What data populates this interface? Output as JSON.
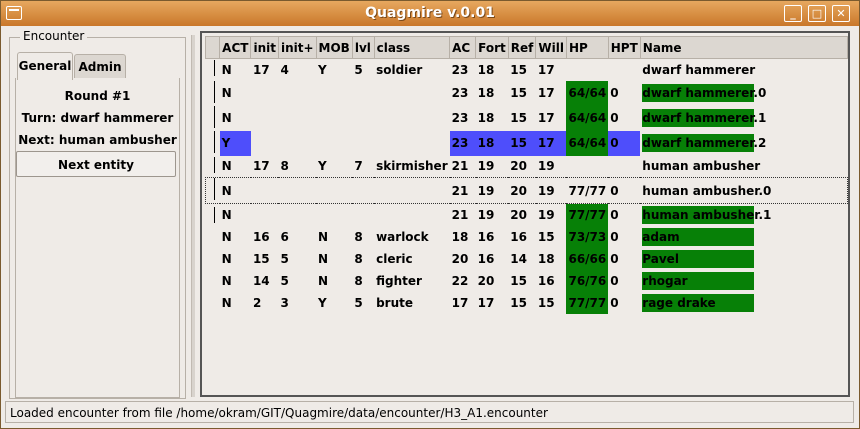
{
  "window": {
    "title": "Quagmire v.0.01"
  },
  "left": {
    "frame_label": "Encounter",
    "tabs": [
      {
        "label": "General"
      },
      {
        "label": "Admin"
      }
    ],
    "round": "Round #1",
    "turn": "Turn: dwarf hammerer",
    "next": "Next: human ambusher",
    "next_button": "Next entity"
  },
  "table": {
    "headers": [
      "ACT",
      "init",
      "init+",
      "MOB",
      "lvl",
      "class",
      "AC",
      "Fort",
      "Ref",
      "Will",
      "HP",
      "HPT",
      "Name"
    ],
    "rows": [
      {
        "act": "N",
        "init": "17",
        "initp": "4",
        "mob": "Y",
        "lvl": "5",
        "cls": "soldier",
        "ac": "23",
        "fort": "18",
        "ref": "15",
        "will": "17",
        "hp": "",
        "hpt": "",
        "name": "dwarf hammerer"
      },
      {
        "act": "N",
        "init": "",
        "initp": "",
        "mob": "",
        "lvl": "",
        "cls": "",
        "ac": "23",
        "fort": "18",
        "ref": "15",
        "will": "17",
        "hp": "64/64",
        "hpt": "0",
        "name": "dwarf hammerer.0"
      },
      {
        "act": "N",
        "init": "",
        "initp": "",
        "mob": "",
        "lvl": "",
        "cls": "",
        "ac": "23",
        "fort": "18",
        "ref": "15",
        "will": "17",
        "hp": "64/64",
        "hpt": "0",
        "name": "dwarf hammerer.1"
      },
      {
        "act": "Y",
        "init": "",
        "initp": "",
        "mob": "",
        "lvl": "",
        "cls": "",
        "ac": "23",
        "fort": "18",
        "ref": "15",
        "will": "17",
        "hp": "64/64",
        "hpt": "0",
        "name": "dwarf hammerer.2"
      },
      {
        "act": "N",
        "init": "17",
        "initp": "8",
        "mob": "Y",
        "lvl": "7",
        "cls": "skirmisher",
        "ac": "21",
        "fort": "19",
        "ref": "20",
        "will": "19",
        "hp": "",
        "hpt": "",
        "name": "human ambusher"
      },
      {
        "act": "N",
        "init": "",
        "initp": "",
        "mob": "",
        "lvl": "",
        "cls": "",
        "ac": "21",
        "fort": "19",
        "ref": "20",
        "will": "19",
        "hp": "77/77",
        "hpt": "0",
        "name": "human ambusher.0"
      },
      {
        "act": "N",
        "init": "",
        "initp": "",
        "mob": "",
        "lvl": "",
        "cls": "",
        "ac": "21",
        "fort": "19",
        "ref": "20",
        "will": "19",
        "hp": "77/77",
        "hpt": "0",
        "name": "human ambusher.1"
      },
      {
        "act": "N",
        "init": "16",
        "initp": "6",
        "mob": "N",
        "lvl": "8",
        "cls": "warlock",
        "ac": "18",
        "fort": "16",
        "ref": "16",
        "will": "15",
        "hp": "73/73",
        "hpt": "0",
        "name": "adam"
      },
      {
        "act": "N",
        "init": "15",
        "initp": "5",
        "mob": "N",
        "lvl": "8",
        "cls": "cleric",
        "ac": "20",
        "fort": "16",
        "ref": "14",
        "will": "18",
        "hp": "66/66",
        "hpt": "0",
        "name": "Pavel"
      },
      {
        "act": "N",
        "init": "14",
        "initp": "5",
        "mob": "N",
        "lvl": "8",
        "cls": "fighter",
        "ac": "22",
        "fort": "20",
        "ref": "15",
        "will": "16",
        "hp": "76/76",
        "hpt": "0",
        "name": "rhogar"
      },
      {
        "act": "N",
        "init": "2",
        "initp": "3",
        "mob": "Y",
        "lvl": "5",
        "cls": "brute",
        "ac": "17",
        "fort": "17",
        "ref": "15",
        "will": "15",
        "hp": "77/77",
        "hpt": "0",
        "name": "rage drake"
      }
    ]
  },
  "status": {
    "text": "Loaded encounter from file  /home/okram/GIT/Quagmire/data/encounter/H3_A1.encounter"
  },
  "colors": {
    "title_bar": "#d88a3c",
    "green": "#078007",
    "blue": "#4e4efb"
  }
}
